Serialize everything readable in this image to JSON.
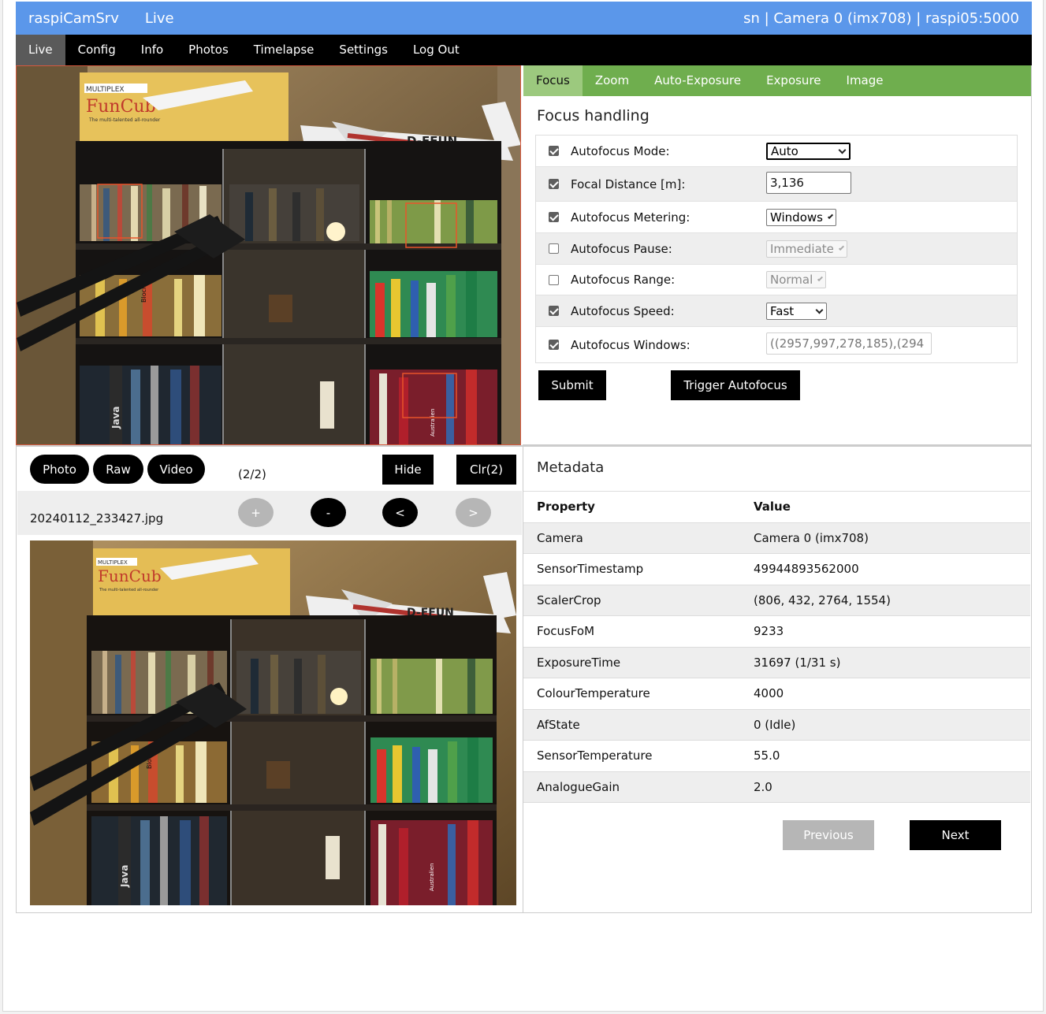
{
  "header": {
    "brand": "raspiCamSrv",
    "page": "Live",
    "ident": "sn | Camera 0 (imx708) | raspi05:5000"
  },
  "nav": [
    "Live",
    "Config",
    "Info",
    "Photos",
    "Timelapse",
    "Settings",
    "Log Out"
  ],
  "tabs": [
    "Focus",
    "Zoom",
    "Auto-Exposure",
    "Exposure",
    "Image"
  ],
  "focus": {
    "title": "Focus handling",
    "rows": [
      {
        "label": "Autofocus Mode:",
        "checked": true,
        "value": "Auto"
      },
      {
        "label": "Focal Distance [m]:",
        "checked": true,
        "value": "3,136"
      },
      {
        "label": "Autofocus Metering:",
        "checked": true,
        "value": "Windows"
      },
      {
        "label": "Autofocus Pause:",
        "checked": false,
        "value": "Immediate"
      },
      {
        "label": "Autofocus Range:",
        "checked": false,
        "value": "Normal"
      },
      {
        "label": "Autofocus Speed:",
        "checked": true,
        "value": "Fast"
      },
      {
        "label": "Autofocus Windows:",
        "checked": true,
        "value": "((2957,997,278,185),(294"
      }
    ],
    "submit": "Submit",
    "trigger": "Trigger Autofocus"
  },
  "photo": {
    "buttons": {
      "photo": "Photo",
      "raw": "Raw",
      "video": "Video",
      "hide": "Hide",
      "clear": "Clr(2)"
    },
    "counter": "(2/2)",
    "filename": "20240112_233427.jpg",
    "nav": {
      "plus": "+",
      "minus": "-",
      "prev": "<",
      "next": ">"
    }
  },
  "live_preview": {
    "photo_labels": [
      "MULTIPLEX",
      "FunCub",
      "The multi-talented all-rounder",
      "D-EFUN"
    ],
    "spine_labels": [
      "Java",
      "Bloch",
      "Australien"
    ]
  },
  "captured_photo": {
    "photo_labels": [
      "MULTIPLEX",
      "FunCub",
      "The multi-talented all-rounder",
      "D-EFUN"
    ],
    "spine_labels": [
      "Java",
      "Bloch",
      "Australien"
    ]
  },
  "metadata": {
    "title": "Metadata",
    "head": {
      "k": "Property",
      "v": "Value"
    },
    "rows": [
      {
        "k": "Camera",
        "v": "Camera 0 (imx708)"
      },
      {
        "k": "SensorTimestamp",
        "v": "49944893562000"
      },
      {
        "k": "ScalerCrop",
        "v": "(806, 432, 2764, 1554)"
      },
      {
        "k": "FocusFoM",
        "v": "9233"
      },
      {
        "k": "ExposureTime",
        "v": "31697 (1/31 s)"
      },
      {
        "k": "ColourTemperature",
        "v": "4000"
      },
      {
        "k": "AfState",
        "v": "0 (Idle)"
      },
      {
        "k": "SensorTemperature",
        "v": "55.0"
      },
      {
        "k": "AnalogueGain",
        "v": "2.0"
      }
    ],
    "previous": "Previous",
    "next": "Next"
  },
  "colors": {
    "header": "#5b97ea",
    "tabbar": "#6fae4e",
    "tab_active": "#9cc97e",
    "af_window": "#e8542a"
  }
}
